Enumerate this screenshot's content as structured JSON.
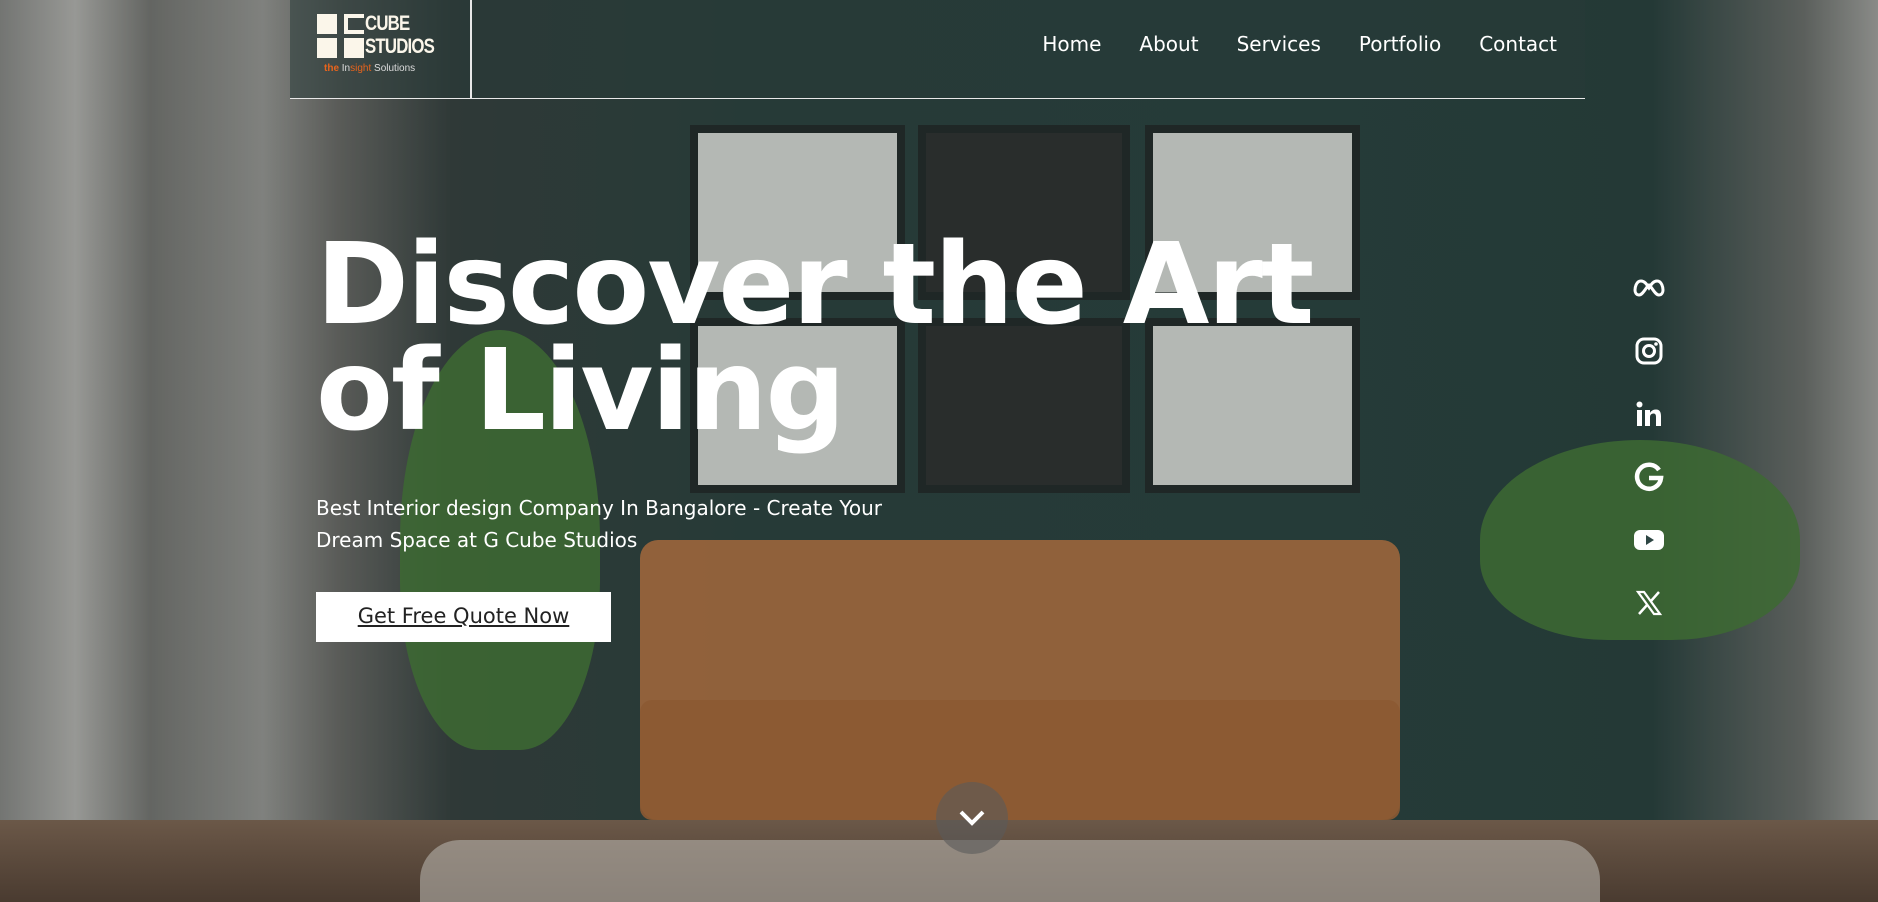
{
  "logo": {
    "line1": "CUBE",
    "line2": "STUDIOS",
    "tagline_the": "the",
    "tagline_in": "In",
    "tagline_sight": "sight",
    "tagline_rest": " Solutions",
    "accent": "#e8641c"
  },
  "nav": {
    "items": [
      {
        "label": "Home"
      },
      {
        "label": "About"
      },
      {
        "label": "Services"
      },
      {
        "label": "Portfolio"
      },
      {
        "label": "Contact"
      }
    ]
  },
  "hero": {
    "title": "Discover the Art of Living",
    "subtitle": "Best Interior design Company In Bangalore - Create Your Dream Space at G Cube Studios",
    "cta": "Get Free Quote Now"
  },
  "social": [
    "meta-icon",
    "instagram-icon",
    "linkedin-icon",
    "google-icon",
    "youtube-icon",
    "x-icon"
  ],
  "scroll": {
    "icon": "chevron-down-icon"
  }
}
